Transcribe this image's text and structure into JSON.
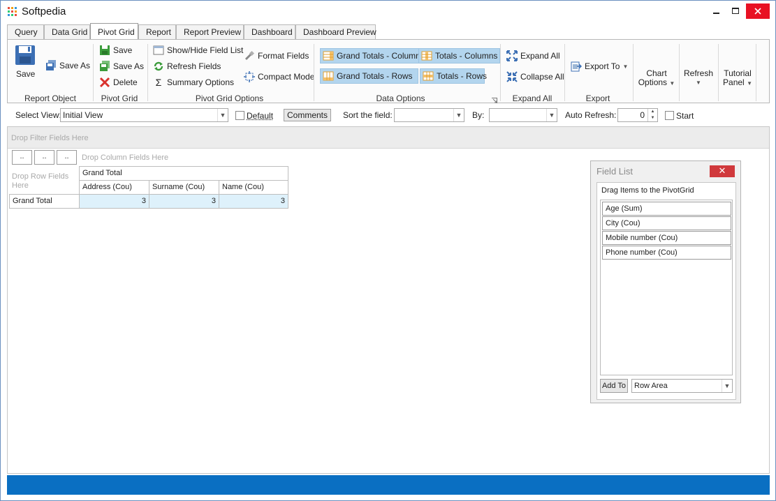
{
  "window": {
    "title": "Softpedia"
  },
  "tabs": [
    "Query",
    "Data Grid",
    "Pivot Grid",
    "Report",
    "Report Preview",
    "Dashboard",
    "Dashboard Preview"
  ],
  "ribbon": {
    "report_object": {
      "save": "Save",
      "save_as": "Save As",
      "label": "Report Object"
    },
    "pivot_grid": {
      "save": "Save",
      "save_as": "Save As",
      "delete": "Delete",
      "label": "Pivot Grid"
    },
    "pivot_grid_options": {
      "show_hide_field_list": "Show/Hide Field List",
      "refresh_fields": "Refresh Fields",
      "summary_options": "Summary Options",
      "format_fields": "Format Fields",
      "compact_mode": "Compact Mode",
      "label": "Pivot Grid Options"
    },
    "data_options": {
      "grand_totals_columns": "Grand Totals - Columns",
      "totals_columns": "Totals - Columns",
      "grand_totals_rows": "Grand Totals - Rows",
      "totals_rows": "Totals - Rows",
      "label": "Data Options"
    },
    "expand_all": {
      "expand": "Expand All",
      "collapse": "Collapse All",
      "label": "Expand All"
    },
    "export": {
      "export_to": "Export To",
      "label": "Export"
    },
    "chart_options": {
      "line1": "Chart",
      "line2": "Options"
    },
    "refresh": "Refresh",
    "tutorial_panel": {
      "line1": "Tutorial",
      "line2": "Panel"
    }
  },
  "options_bar": {
    "select_view_label": "Select View:",
    "select_view_value": "Initial View",
    "default_label": "Default",
    "comments": "Comments",
    "sort_label": "Sort the field:",
    "by_label": "By:",
    "auto_refresh_label": "Auto Refresh:",
    "auto_refresh_value": "0",
    "start_label": "Start"
  },
  "pivot": {
    "drop_filter": "Drop Filter Fields Here",
    "drop_column": "Drop Column Fields Here",
    "drop_row": "Drop Row Fields Here",
    "small_buttons": [
      "..",
      "..",
      ".."
    ],
    "grand_total_header": "Grand Total",
    "columns": [
      "Address (Cou)",
      "Surname (Cou)",
      "Name (Cou)"
    ],
    "row_label": "Grand Total",
    "values": [
      "3",
      "3",
      "3"
    ]
  },
  "field_list": {
    "title": "Field List",
    "close": "✕",
    "drag_text": "Drag Items to the PivotGrid",
    "items": [
      "Age (Sum)",
      "City (Cou)",
      "Mobile number (Cou)",
      "Phone number (Cou)"
    ],
    "add_to": "Add To",
    "area": "Row Area"
  },
  "colors": {
    "accent": "#0a6fc2",
    "highlight": "#b3d5ee",
    "close": "#d0393c"
  }
}
